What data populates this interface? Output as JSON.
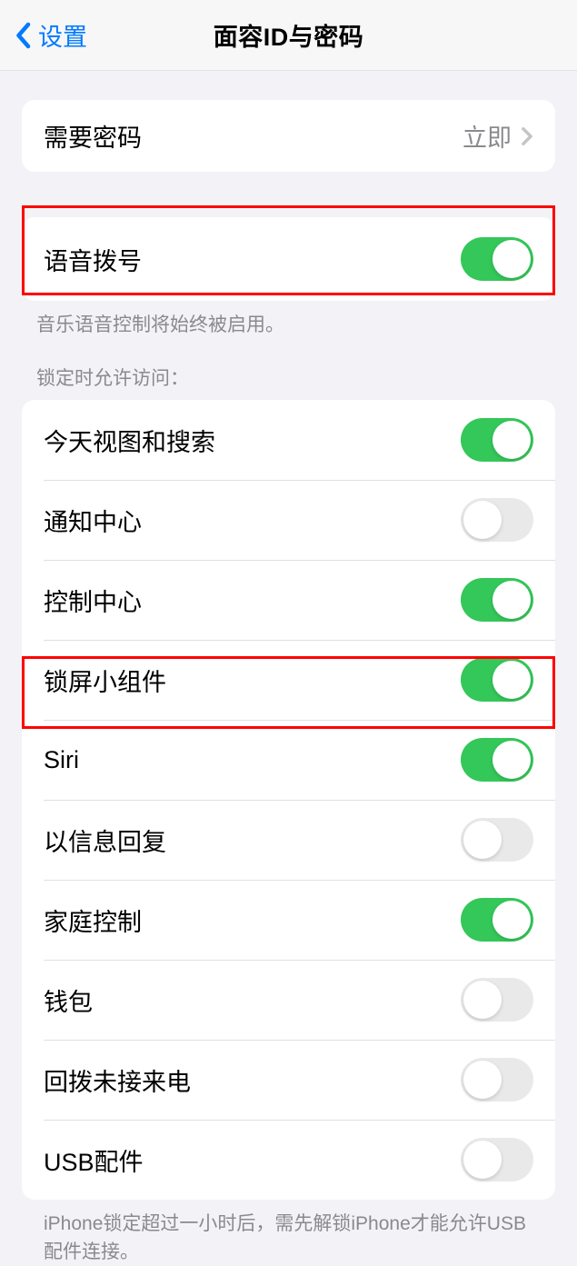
{
  "header": {
    "back_label": "设置",
    "title": "面容ID与密码"
  },
  "group_passcode": {
    "require_passcode_label": "需要密码",
    "require_passcode_value": "立即"
  },
  "group_voice": {
    "voice_dial_label": "语音拨号",
    "voice_dial_on": true,
    "footer": "音乐语音控制将始终被启用。"
  },
  "group_lock_access": {
    "header": "锁定时允许访问：",
    "items": [
      {
        "label": "今天视图和搜索",
        "on": true
      },
      {
        "label": "通知中心",
        "on": false
      },
      {
        "label": "控制中心",
        "on": true
      },
      {
        "label": "锁屏小组件",
        "on": true
      },
      {
        "label": "Siri",
        "on": true
      },
      {
        "label": "以信息回复",
        "on": false
      },
      {
        "label": "家庭控制",
        "on": true
      },
      {
        "label": "钱包",
        "on": false
      },
      {
        "label": "回拨未接来电",
        "on": false
      },
      {
        "label": "USB配件",
        "on": false
      }
    ],
    "footer": "iPhone锁定超过一小时后，需先解锁iPhone才能允许USB配件连接。"
  }
}
